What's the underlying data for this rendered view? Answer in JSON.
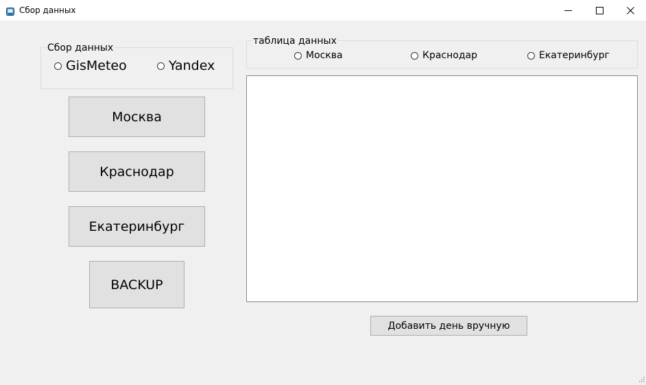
{
  "window": {
    "title": "Сбор данных",
    "icons": {
      "app": "app-icon",
      "minimize": "minimize-icon",
      "maximize": "maximize-icon",
      "close": "close-icon"
    }
  },
  "collection_group": {
    "legend": "Сбор данных",
    "options": [
      {
        "label": "GisMeteo",
        "selected": false
      },
      {
        "label": "Yandex",
        "selected": false
      }
    ]
  },
  "city_buttons": [
    {
      "label": "Москва"
    },
    {
      "label": "Краснодар"
    },
    {
      "label": "Екатеринбург"
    }
  ],
  "backup_button": {
    "label": "BACKUP"
  },
  "table_group": {
    "legend": "таблица данных",
    "options": [
      {
        "label": "Москва",
        "selected": false
      },
      {
        "label": "Краснодар",
        "selected": false
      },
      {
        "label": "Екатеринбург",
        "selected": false
      }
    ]
  },
  "data_list": {
    "items": []
  },
  "add_day_button": {
    "label": "Добавить день вручную"
  }
}
